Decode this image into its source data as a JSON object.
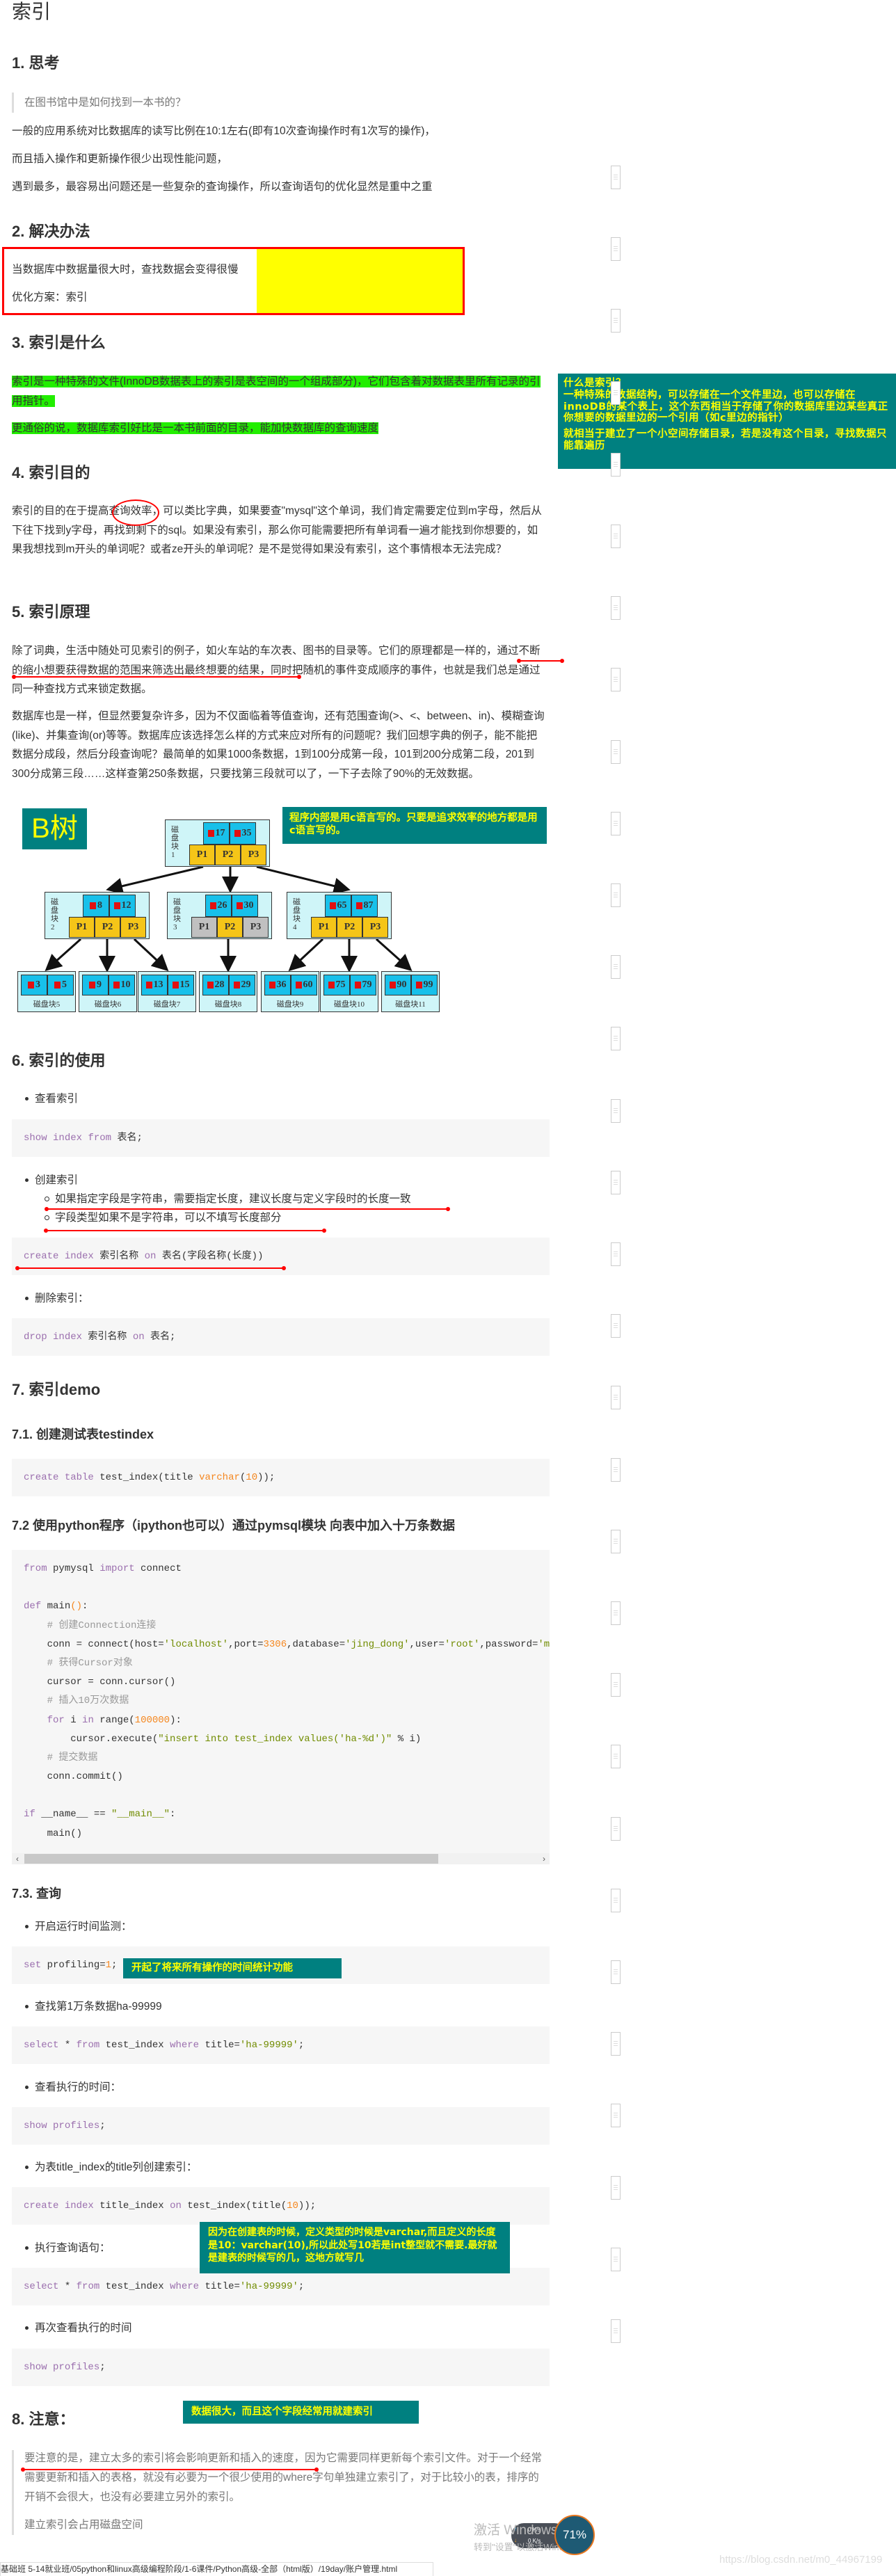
{
  "title": "索引",
  "s1": {
    "heading": "1. 思考",
    "quote": "在图书馆中是如何找到一本书的？",
    "paragraphs": [
      "一般的应用系统对比数据库的读写比例在10:1左右(即有10次查询操作时有1次写的操作)，",
      "而且插入操作和更新操作很少出现性能问题，",
      "遇到最多，最容易出问题还是一些复杂的查询操作，所以查询语句的优化显然是重中之重"
    ]
  },
  "s2": {
    "heading": "2. 解决办法",
    "line1": "当数据库中数据量很大时，查找数据会变得很慢",
    "line2": "优化方案：索引"
  },
  "s3": {
    "heading": "3. 索引是什么",
    "highlight": "索引是一种特殊的文件(InnoDB数据表上的索引是表空间的一个组成部分)，它们包含着对数据表里所有记录的引用指针。",
    "highlight2": "更通俗的说，数据库索引好比是一本书前面的目录，能加快数据库的查询速度",
    "note": {
      "title": "什么是索引？",
      "body": "一种特殊的数据结构，可以存储在一个文件里边，也可以存储在innoDB的某个表上，这个东西相当于存储了你的数据库里边某些真正你想要的数据里边的一个引用（如c里边的指针）",
      "body2": "就相当于建立了一个小空间存储目录，若是没有这个目录，寻找数据只能靠遍历"
    }
  },
  "s4": {
    "heading": "4. 索引目的",
    "p_before": "索引的目的在于提高",
    "p_circled": "查询效率",
    "p_after": "，可以类比字典，如果要查\"mysql\"这个单词，我们肯定需要定位到m字母，然后从下往下找到y字母，再找到剩下的sql。如果没有索引，那么你可能需要把所有单词看一遍才能找到你想要的，如果我想找到m开头的单词呢？或者ze开头的单词呢？是不是觉得如果没有索引，这个事情根本无法完成？"
  },
  "s5": {
    "heading": "5. 索引原理",
    "p1": "除了词典，生活中随处可见索引的例子，如火车站的车次表、图书的目录等。它们的原理都是一样的，通过不断的缩小想要获得数据的范围来筛选出最终想要的结果，同时把随机的事件变成顺序的事件，也就是我们总是通过同一种查找方式来锁定数据。",
    "p2": "数据库也是一样，但显然要复杂许多，因为不仅面临着等值查询，还有范围查询(>、<、between、in)、模糊查询(like)、并集查询(or)等等。数据库应该选择怎么样的方式来应对所有的问题呢？我们回想字典的例子，能不能把数据分成段，然后分段查询呢？最简单的如果1000条数据，1到100分成第一段，101到200分成第二段，201到300分成第三段……这样查第250条数据，只要找第三段就可以了，一下子去除了90%的无效数据。",
    "btree_label": "B树",
    "note": "程序内部是用c语言写的。只要是追求效率的地方都是用c语言写的。",
    "btree": {
      "root": {
        "label": "磁盘块1",
        "keys": [
          "17",
          "35"
        ],
        "pointers": [
          "P1",
          "P2",
          "P3"
        ]
      },
      "level2": [
        {
          "label": "磁盘块2",
          "keys": [
            "8",
            "12"
          ],
          "pointers": [
            "P1",
            "P2",
            "P3"
          ],
          "inactive": []
        },
        {
          "label": "磁盘块3",
          "keys": [
            "26",
            "30"
          ],
          "pointers": [
            "P1",
            "P2",
            "P3"
          ],
          "inactive": [
            0,
            2
          ]
        },
        {
          "label": "磁盘块4",
          "keys": [
            "65",
            "87"
          ],
          "pointers": [
            "P1",
            "P2",
            "P3"
          ],
          "inactive": []
        }
      ],
      "leaves": [
        {
          "label": "磁盘块5",
          "keys": [
            "3",
            "5"
          ]
        },
        {
          "label": "磁盘块6",
          "keys": [
            "9",
            "10"
          ]
        },
        {
          "label": "磁盘块7",
          "keys": [
            "13",
            "15"
          ]
        },
        {
          "label": "磁盘块8",
          "keys": [
            "28",
            "29"
          ]
        },
        {
          "label": "磁盘块9",
          "keys": [
            "36",
            "60"
          ]
        },
        {
          "label": "磁盘块10",
          "keys": [
            "75",
            "79"
          ]
        },
        {
          "label": "磁盘块11",
          "keys": [
            "90",
            "99"
          ]
        }
      ]
    }
  },
  "s6": {
    "heading": "6. 索引的使用",
    "b1": "查看索引",
    "code1": [
      [
        [
          "show",
          "k"
        ],
        [
          " ",
          "p"
        ],
        [
          "index",
          "k"
        ],
        [
          " ",
          "p"
        ],
        [
          "from",
          "k"
        ],
        [
          " 表名;",
          "p"
        ]
      ]
    ],
    "b2": "创建索引",
    "sub1": "如果指定字段是字符串，需要指定长度，建议长度与定义字段时的长度一致",
    "sub2": "字段类型如果不是字符串，可以不填写长度部分",
    "code2": [
      [
        [
          "create",
          "k"
        ],
        [
          " ",
          "p"
        ],
        [
          "index",
          "k"
        ],
        [
          " 索引名称 ",
          "p"
        ],
        [
          "on",
          "k"
        ],
        [
          " 表名(字段名称(长度))",
          "p"
        ]
      ]
    ],
    "b3": "删除索引：",
    "code3": [
      [
        [
          "drop",
          "k"
        ],
        [
          " ",
          "p"
        ],
        [
          "index",
          "k"
        ],
        [
          " 索引名称 ",
          "p"
        ],
        [
          "on",
          "k"
        ],
        [
          " 表名;",
          "p"
        ]
      ]
    ]
  },
  "s7": {
    "heading": "7. 索引demo",
    "h71": "7.1. 创建测试表testindex",
    "code71": [
      [
        [
          "create",
          "k"
        ],
        [
          " ",
          "p"
        ],
        [
          "table",
          "k"
        ],
        [
          " test_index(title ",
          "p"
        ],
        [
          "varchar",
          "n"
        ],
        [
          "(",
          "p"
        ],
        [
          "10",
          "n"
        ],
        [
          "));",
          "p"
        ]
      ]
    ],
    "h72": "7.2 使用python程序（ipython也可以）通过pymsql模块 向表中加入十万条数据",
    "code72": [
      [
        [
          "from",
          "k"
        ],
        [
          " pymysql ",
          "p"
        ],
        [
          "import",
          "k"
        ],
        [
          " connect",
          "p"
        ]
      ],
      [],
      [
        [
          "def",
          "k"
        ],
        [
          " main",
          "p"
        ],
        [
          "()",
          "n"
        ],
        [
          ":",
          "p"
        ]
      ],
      [
        [
          "    # 创建Connection连接",
          "c"
        ]
      ],
      [
        [
          "    conn = connect(host=",
          "p"
        ],
        [
          "'localhost'",
          "s"
        ],
        [
          ",port=",
          "p"
        ],
        [
          "3306",
          "n"
        ],
        [
          ",database=",
          "p"
        ],
        [
          "'jing_dong'",
          "s"
        ],
        [
          ",user=",
          "p"
        ],
        [
          "'root'",
          "s"
        ],
        [
          ",password=",
          "p"
        ],
        [
          "'mys",
          "s"
        ]
      ],
      [
        [
          "    # 获得Cursor对象",
          "c"
        ]
      ],
      [
        [
          "    cursor = conn.cursor()",
          "p"
        ]
      ],
      [
        [
          "    # 插入10万次数据",
          "c"
        ]
      ],
      [
        [
          "    ",
          "p"
        ],
        [
          "for",
          "k"
        ],
        [
          " i ",
          "p"
        ],
        [
          "in",
          "k"
        ],
        [
          " range(",
          "p"
        ],
        [
          "100000",
          "n"
        ],
        [
          "):",
          "p"
        ]
      ],
      [
        [
          "        cursor.execute(",
          "p"
        ],
        [
          "\"insert into test_index values('ha-%d')\"",
          "s"
        ],
        [
          " % i)",
          "p"
        ]
      ],
      [
        [
          "    # 提交数据",
          "c"
        ]
      ],
      [
        [
          "    conn.commit()",
          "p"
        ]
      ],
      [],
      [
        [
          "if",
          "k"
        ],
        [
          " __name__ == ",
          "p"
        ],
        [
          "\"__main__\"",
          "s"
        ],
        [
          ":",
          "p"
        ]
      ],
      [
        [
          "    main()",
          "p"
        ]
      ]
    ],
    "h73": "7.3. 查询",
    "b1": "开启运行时间监测：",
    "code_b1": [
      [
        [
          "set",
          "k"
        ],
        [
          " profiling=",
          "p"
        ],
        [
          "1",
          "n"
        ],
        [
          ";",
          "p"
        ]
      ]
    ],
    "note1": "开起了将来所有操作的时间统计功能",
    "b2": "查找第1万条数据ha-99999",
    "code_b2": [
      [
        [
          "select",
          "k"
        ],
        [
          " * ",
          "p"
        ],
        [
          "from",
          "k"
        ],
        [
          " test_index ",
          "p"
        ],
        [
          "where",
          "k"
        ],
        [
          " title=",
          "p"
        ],
        [
          "'ha-99999'",
          "s"
        ],
        [
          ";",
          "p"
        ]
      ]
    ],
    "b3": "查看执行的时间：",
    "code_b3": [
      [
        [
          "show",
          "k"
        ],
        [
          " ",
          "p"
        ],
        [
          "profiles",
          "k"
        ],
        [
          ";",
          "p"
        ]
      ]
    ],
    "b4": "为表title_index的title列创建索引：",
    "code_b4": [
      [
        [
          "create",
          "k"
        ],
        [
          " ",
          "p"
        ],
        [
          "index",
          "k"
        ],
        [
          " title_index ",
          "p"
        ],
        [
          "on",
          "k"
        ],
        [
          " test_index(title(",
          "p"
        ],
        [
          "10",
          "n"
        ],
        [
          "));",
          "p"
        ]
      ]
    ],
    "note2": "因为在创建表的时候，定义类型的时候是varchar,而且定义的长度是10：varchar(10),所以此处写10若是int整型就不需要.最好就是建表的时候写的几，这地方就写几",
    "b5": "执行查询语句：",
    "code_b5": [
      [
        [
          "select",
          "k"
        ],
        [
          " * ",
          "p"
        ],
        [
          "from",
          "k"
        ],
        [
          " test_index ",
          "p"
        ],
        [
          "where",
          "k"
        ],
        [
          " title=",
          "p"
        ],
        [
          "'ha-99999'",
          "s"
        ],
        [
          ";",
          "p"
        ]
      ]
    ],
    "b6": "再次查看执行的时间",
    "code_b6": [
      [
        [
          "show",
          "k"
        ],
        [
          " ",
          "p"
        ],
        [
          "profiles",
          "k"
        ],
        [
          ";",
          "p"
        ]
      ]
    ]
  },
  "s8": {
    "heading": "8. 注意：",
    "note": "数据很大，而且这个字段经常用就建索引",
    "quote": "要注意的是，建立太多的索引将会影响更新和插入的速度，因为它需要同样更新每个索引文件。对于一个经常需要更新和插入的表格，就没有必要为一个很少使用的where字句单独建立索引了，对于比较小的表，排序的开销不会很大，也没有必要建立另外的索引。",
    "quote2": "建立索引会占用磁盘空间"
  },
  "overlay": {
    "activate_title": "激活 Windows",
    "activate_sub": "转到\"设置\"以激活Windows。",
    "net_up": "0 K/s",
    "net_down": "0 K/s",
    "cpu_percent": "71%",
    "watermark": "https://blog.csdn.net/m0_44967199",
    "status_path": "基础班  5-14就业班/05python和linux高级编程阶段/1-6课件/Python高级-全部（html版）/19day/账户管理.html"
  },
  "colors": {
    "teal": "#008080",
    "note_text": "#ffff00",
    "highlight": "#22ee00",
    "annotation_red": "#ff0000"
  }
}
